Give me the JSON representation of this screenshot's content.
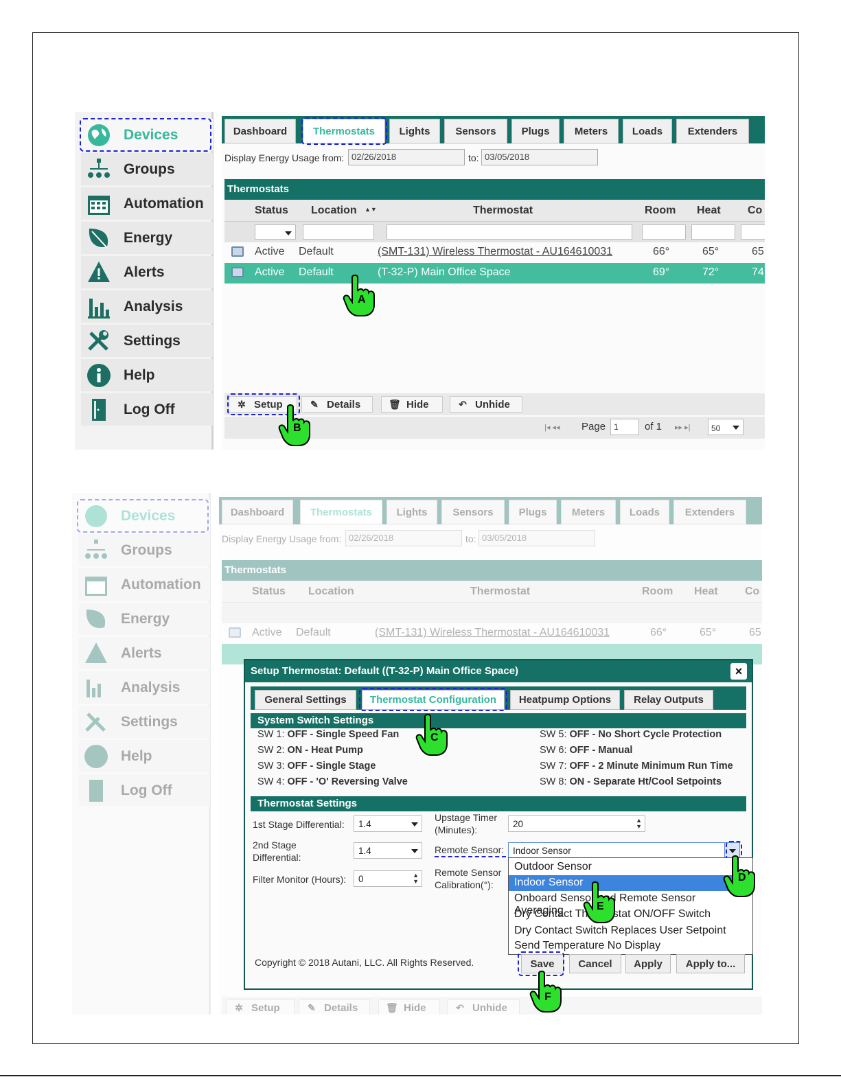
{
  "nav": [
    {
      "label": "Devices",
      "icon": "globe-icon"
    },
    {
      "label": "Groups",
      "icon": "hierarchy-icon"
    },
    {
      "label": "Automation",
      "icon": "calendar-icon"
    },
    {
      "label": "Energy",
      "icon": "leaf-icon"
    },
    {
      "label": "Alerts",
      "icon": "warning-icon"
    },
    {
      "label": "Analysis",
      "icon": "bar-chart-icon"
    },
    {
      "label": "Settings",
      "icon": "tools-icon"
    },
    {
      "label": "Help",
      "icon": "info-icon"
    },
    {
      "label": "Log Off",
      "icon": "door-icon"
    }
  ],
  "tabs": [
    "Dashboard",
    "Thermostats",
    "Lights",
    "Sensors",
    "Plugs",
    "Meters",
    "Loads",
    "Extenders"
  ],
  "date_range": {
    "label_from": "Display Energy Usage from:",
    "from": "02/26/2018",
    "label_to": "to:",
    "to": "03/05/2018"
  },
  "panel_title": "Thermostats",
  "columns": [
    "Status",
    "Location",
    "Thermostat",
    "Room",
    "Heat",
    "Co"
  ],
  "sort_indicator": "▲▼",
  "rows": [
    {
      "status": "Active",
      "location": "Default",
      "thermostat": "(SMT-131) Wireless Thermostat - AU164610031",
      "room": "66°",
      "heat": "65°",
      "cool": "65"
    },
    {
      "status": "Active",
      "location": "Default",
      "thermostat": "(T-32-P) Main Office Space",
      "room": "69°",
      "heat": "72°",
      "cool": "74"
    }
  ],
  "toolbar": [
    "Setup",
    "Details",
    "Hide",
    "Unhide"
  ],
  "pager": {
    "page_label": "Page",
    "page": "1",
    "of_label": "of 1",
    "page_size": "50"
  },
  "callouts": [
    "A",
    "B",
    "C",
    "D",
    "E",
    "F"
  ],
  "dialog": {
    "title": "Setup Thermostat: Default ((T-32-P) Main Office Space)",
    "close": "×",
    "tabs": [
      "General Settings",
      "Thermostat Configuration",
      "Heatpump Options",
      "Relay Outputs"
    ],
    "system_switch_title": "System Switch Settings",
    "switches_left": [
      {
        "sw": "SW 1:",
        "val": "OFF - Single Speed Fan"
      },
      {
        "sw": "SW 2:",
        "val": "ON - Heat Pump"
      },
      {
        "sw": "SW 3:",
        "val": "OFF - Single Stage"
      },
      {
        "sw": "SW 4:",
        "val": "OFF - 'O' Reversing Valve"
      }
    ],
    "switches_right": [
      {
        "sw": "SW 5:",
        "val": "OFF - No Short Cycle Protection"
      },
      {
        "sw": "SW 6:",
        "val": "OFF - Manual"
      },
      {
        "sw": "SW 7:",
        "val": "OFF - 2 Minute Minimum Run Time"
      },
      {
        "sw": "SW 8:",
        "val": "ON - Separate Ht/Cool Setpoints"
      }
    ],
    "thermostat_settings_title": "Thermostat Settings",
    "fields": {
      "stage1_label": "1st Stage Differential:",
      "stage1_value": "1.4",
      "stage2_label": "2nd Stage Differential:",
      "stage2_value": "1.4",
      "filter_label": "Filter Monitor (Hours):",
      "filter_value": "0",
      "upstage_label": "Upstage Timer (Minutes):",
      "upstage_value": "20",
      "remote_label": "Remote Sensor:",
      "remote_value": "Indoor Sensor",
      "calib_label": "Remote Sensor Calibration(°):"
    },
    "remote_options": [
      "Outdoor Sensor",
      "Indoor Sensor",
      "Onboard Sensor and Remote Sensor Averaging",
      "Dry Contact Thermostat ON/OFF Switch",
      "Dry Contact Switch Replaces User Setpoint",
      "Send Temperature No Display"
    ],
    "copyright": "Copyright © 2018 Autani, LLC. All Rights Reserved.",
    "buttons": [
      "Save",
      "Cancel",
      "Apply",
      "Apply to..."
    ]
  },
  "colors": {
    "brand": "#157165",
    "accent": "#36b89c",
    "selected_row": "#44bd9f",
    "callout": "#1a23d6",
    "hand": "#22dd22"
  }
}
